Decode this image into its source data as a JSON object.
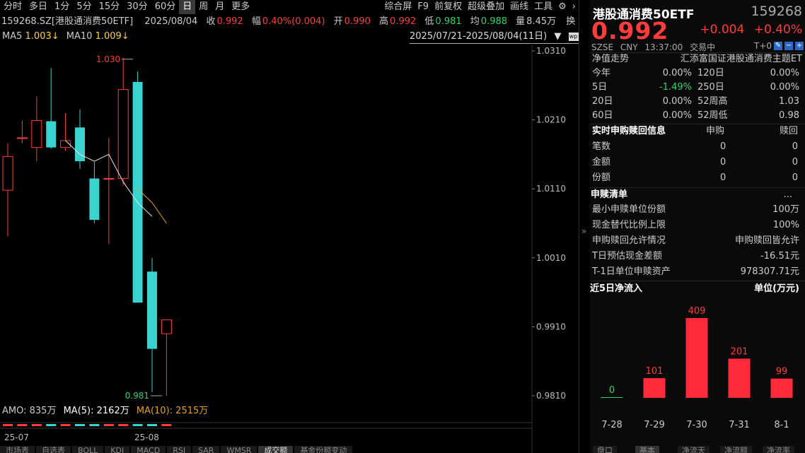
{
  "toolbar": {
    "periods": [
      "分时",
      "多日",
      "1分",
      "5分",
      "15分",
      "30分",
      "60分",
      "日",
      "周",
      "月",
      "更多"
    ],
    "active_period": "日",
    "right_tools": [
      "综合屏",
      "F9",
      "前复权",
      "超级叠加",
      "画线",
      "工具"
    ],
    "gear_icon": "gear-icon",
    "next_icon": "chevron-right-icon"
  },
  "quote": {
    "symbol": "159268.SZ[港股通消费50ETF]",
    "date": "2025/08/04",
    "close_label": "收",
    "close": "0.992",
    "amp_label": "幅",
    "amp": "0.40%(0.004)",
    "open_label": "开",
    "open": "0.990",
    "high_label": "高",
    "high": "0.992",
    "low_label": "低",
    "low": "0.981",
    "avg_label": "均",
    "avg": "0.988",
    "vol_label": "量",
    "vol": "8.45万",
    "swap_label": "换",
    "wp_icon": "wp-icon"
  },
  "ma": {
    "ma5_label": "MA5",
    "ma5": "1.003↓",
    "ma10_label": "MA10",
    "ma10": "1.009↓"
  },
  "range": "2025/07/21-2025/08/04(11日)",
  "amo": {
    "label": "AMO: 835万",
    "ma5": "MA(5): 2162万",
    "ma10": "MA(10): 2515万"
  },
  "colors": {
    "up": "#ff3b3b",
    "down": "#39d3d0",
    "ma5": "#e6e6e6",
    "ma10": "#e8a020",
    "gridline": "#262626",
    "bar": "#ff2a3a"
  },
  "chart_data": {
    "type": "candlestick",
    "x_labels": [
      "25-07",
      "25-08"
    ],
    "y_ticks": [
      "1.0310",
      "1.0210",
      "1.0110",
      "1.0010",
      "0.9910",
      "0.9810"
    ],
    "ylim": [
      0.981,
      1.031
    ],
    "annotations": {
      "high": "1.030",
      "low": "0.981"
    },
    "candles": [
      {
        "o": 1.0108,
        "h": 1.0176,
        "l": 1.0041,
        "c": 1.0157,
        "dir": "up"
      },
      {
        "o": 1.0184,
        "h": 1.0209,
        "l": 1.0176,
        "c": 1.0184,
        "dir": "up"
      },
      {
        "o": 1.017,
        "h": 1.0244,
        "l": 1.015,
        "c": 1.0209,
        "dir": "up"
      },
      {
        "o": 1.0208,
        "h": 1.0285,
        "l": 1.0168,
        "c": 1.017,
        "dir": "down"
      },
      {
        "o": 1.018,
        "h": 1.022,
        "l": 1.0165,
        "c": 1.017,
        "dir": "up"
      },
      {
        "o": 1.0199,
        "h": 1.0225,
        "l": 1.0139,
        "c": 1.015,
        "dir": "down"
      },
      {
        "o": 1.0125,
        "h": 1.0149,
        "l": 1.006,
        "c": 1.0065,
        "dir": "down"
      },
      {
        "o": 1.0125,
        "h": 1.0184,
        "l": 1.003,
        "c": 1.0125,
        "dir": "up"
      },
      {
        "o": 1.0254,
        "h": 1.03,
        "l": 1.0115,
        "c": 1.0125,
        "dir": "up"
      },
      {
        "o": 1.0265,
        "h": 1.028,
        "l": 0.996,
        "c": 0.9945,
        "dir": "down"
      },
      {
        "o": 0.999,
        "h": 1.001,
        "l": 0.9815,
        "c": 0.9878,
        "dir": "down"
      },
      {
        "o": 0.99,
        "h": 0.992,
        "l": 0.981,
        "c": 0.992,
        "dir": "up"
      }
    ],
    "ma5": [
      null,
      null,
      null,
      null,
      1.018,
      1.016,
      1.015,
      1.016,
      1.012,
      1.009,
      1.007
    ],
    "ma10": [
      null,
      null,
      null,
      null,
      null,
      null,
      null,
      null,
      null,
      1.011,
      1.009,
      1.006
    ]
  },
  "right": {
    "name": "港股通消费50ETF",
    "code": "159268",
    "price": "0.992",
    "change": "+0.004",
    "change_pct": "+0.40%",
    "meta": [
      "SZSE",
      "CNY",
      "13:37:00",
      "交易中"
    ],
    "t0": "T+0",
    "nav_title": "净值走势",
    "fund_name": "汇添富国证港股通消费主题ET",
    "perf": [
      {
        "k1": "今年",
        "v1": "0.00%",
        "c1": "gray",
        "k2": "120日",
        "v2": "0.00%"
      },
      {
        "k1": "5日",
        "v1": "-1.49%",
        "c1": "green",
        "k2": "250日",
        "v2": "0.00%"
      },
      {
        "k1": "20日",
        "v1": "0.00%",
        "c1": "gray",
        "k2": "52周高",
        "v2": "1.03"
      },
      {
        "k1": "60日",
        "v1": "0.00%",
        "c1": "gray",
        "k2": "52周低",
        "v2": "0.98"
      }
    ],
    "sub_title": "实时申购赎回信息",
    "sub_col1": "申购",
    "sub_col2": "赎回",
    "sub_rows": [
      {
        "k": "笔数",
        "a": "0",
        "b": "0"
      },
      {
        "k": "金额",
        "a": "0",
        "b": "0"
      },
      {
        "k": "份额",
        "a": "0",
        "b": "0"
      }
    ],
    "list_title": "申赎清单",
    "list_more": "...",
    "list_rows": [
      {
        "k": "最小申赎单位份额",
        "v": "100万"
      },
      {
        "k": "现金替代比例上限",
        "v": "100%"
      },
      {
        "k": "申购赎回允许情况",
        "v": "申购赎回皆允许"
      },
      {
        "k": "T日预估现金差额",
        "v": "-16.51元"
      },
      {
        "k": "T-1日单位申赎资产",
        "v": "978307.71元"
      }
    ],
    "flow_title": "近5日净流入",
    "flow_unit": "单位(万元)",
    "flow_chart": {
      "type": "bar",
      "categories": [
        "7-28",
        "7-29",
        "7-30",
        "7-31",
        "8-1"
      ],
      "values": [
        0,
        101,
        409,
        201,
        99
      ]
    },
    "bottom_tabs": [
      "盘口",
      "基本",
      "净流天",
      "净流额",
      "净流率"
    ]
  },
  "bottom_tabs": [
    "市场表",
    "自选表",
    "BOLL",
    "KDJ",
    "MACD",
    "RSI",
    "SAR",
    "WMSR",
    "成交额",
    "基金份额变动"
  ]
}
